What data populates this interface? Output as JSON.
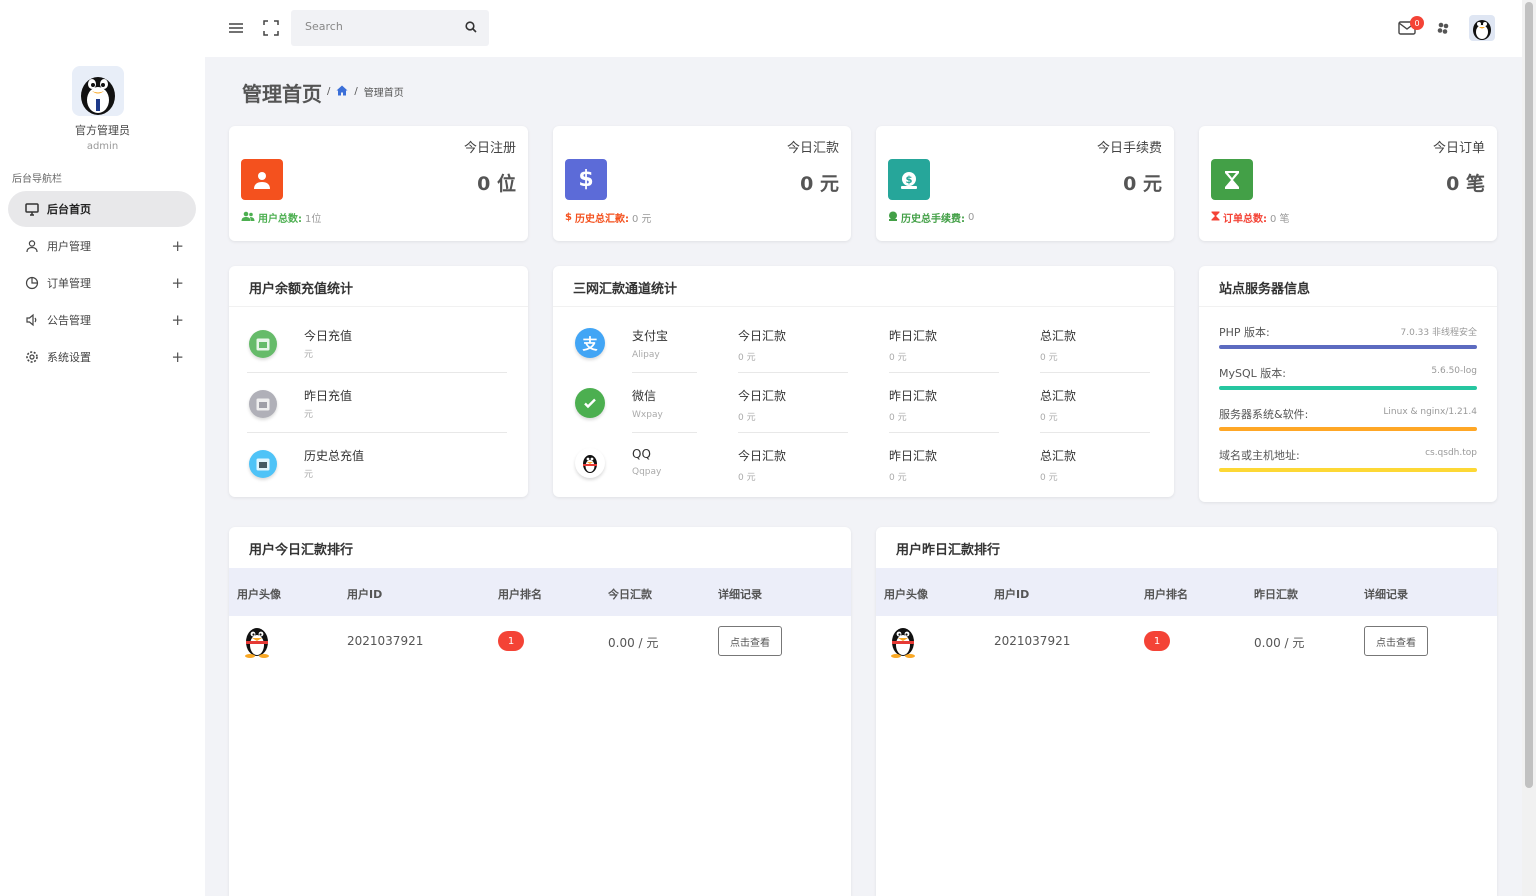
{
  "sidebar": {
    "admin_name": "官方管理员",
    "admin_role": "admin",
    "nav_title": "后台导航栏",
    "items": [
      {
        "label": "后台首页",
        "icon": "monitor-icon",
        "active": true,
        "expandable": false
      },
      {
        "label": "用户管理",
        "icon": "user-icon",
        "expandable": true
      },
      {
        "label": "订单管理",
        "icon": "pie-chart-icon",
        "expandable": true
      },
      {
        "label": "公告管理",
        "icon": "volume-icon",
        "expandable": true
      },
      {
        "label": "系统设置",
        "icon": "gear-icon",
        "expandable": true
      }
    ]
  },
  "topbar": {
    "search_placeholder": "Search",
    "notification_count": "0"
  },
  "header": {
    "title": "管理首页",
    "breadcrumb_sep": "/",
    "breadcrumb_current": "管理首页"
  },
  "stats": [
    {
      "label": "今日注册",
      "value": "0 位",
      "foot_label": "用户总数:",
      "foot_value": "1位",
      "color": "#f4511e",
      "foot_color": "#4caf50",
      "icon": "user-icon"
    },
    {
      "label": "今日汇款",
      "value": "0 元",
      "foot_label": "历史总汇款:",
      "foot_value": "0 元",
      "color": "#5c6bd8",
      "foot_color": "#f4511e",
      "icon": "dollar-icon"
    },
    {
      "label": "今日手续费",
      "value": "0 元",
      "foot_label": "历史总手续费:",
      "foot_value": "0",
      "color": "#26a69a",
      "foot_color": "#43a047",
      "icon": "money-bag-icon"
    },
    {
      "label": "今日订单",
      "value": "0 笔",
      "foot_label": "订单总数:",
      "foot_value": "0 笔",
      "color": "#43a047",
      "foot_color": "#f44336",
      "icon": "hourglass-icon"
    }
  ],
  "recharge": {
    "title": "用户余额充值统计",
    "rows": [
      {
        "label": "今日充值",
        "value": "元",
        "icon": "calendar-today-icon"
      },
      {
        "label": "昨日充值",
        "value": "元",
        "icon": "calendar-yesterday-icon"
      },
      {
        "label": "历史总充值",
        "value": "元",
        "icon": "calendar-history-icon"
      }
    ]
  },
  "channels": {
    "title": "三网汇款通道统计",
    "rows": [
      {
        "name": "支付宝",
        "code": "Alipay",
        "icon": "alipay-icon",
        "today_label": "今日汇款",
        "today_value": "0 元",
        "yesterday_label": "昨日汇款",
        "yesterday_value": "0 元",
        "total_label": "总汇款",
        "total_value": "0 元"
      },
      {
        "name": "微信",
        "code": "Wxpay",
        "icon": "wechat-icon",
        "today_label": "今日汇款",
        "today_value": "0 元",
        "yesterday_label": "昨日汇款",
        "yesterday_value": "0 元",
        "total_label": "总汇款",
        "total_value": "0 元"
      },
      {
        "name": "QQ",
        "code": "Qqpay",
        "icon": "qq-icon",
        "today_label": "今日汇款",
        "today_value": "0 元",
        "yesterday_label": "昨日汇款",
        "yesterday_value": "0 元",
        "total_label": "总汇款",
        "total_value": "0 元"
      }
    ]
  },
  "server": {
    "title": "站点服务器信息",
    "rows": [
      {
        "label": "PHP 版本:",
        "value": "7.0.33 非线程安全",
        "color": "#5c6bc0"
      },
      {
        "label": "MySQL 版本:",
        "value": "5.6.50-log",
        "color": "#26c6a0"
      },
      {
        "label": "服务器系统&软件:",
        "value": "Linux & nginx/1.21.4",
        "color": "#ffa726"
      },
      {
        "label": "域名或主机地址:",
        "value": "cs.qsdh.top",
        "color": "#fdd835"
      }
    ]
  },
  "today_rank": {
    "title": "用户今日汇款排行",
    "headers": [
      "用户头像",
      "用户ID",
      "用户排名",
      "今日汇款",
      "详细记录"
    ],
    "rows": [
      {
        "user_id": "2021037921",
        "rank": "1",
        "amount": "0.00 / 元",
        "action": "点击查看"
      }
    ]
  },
  "yesterday_rank": {
    "title": "用户昨日汇款排行",
    "headers": [
      "用户头像",
      "用户ID",
      "用户排名",
      "昨日汇款",
      "详细记录"
    ],
    "rows": [
      {
        "user_id": "2021037921",
        "rank": "1",
        "amount": "0.00 / 元",
        "action": "点击查看"
      }
    ]
  }
}
